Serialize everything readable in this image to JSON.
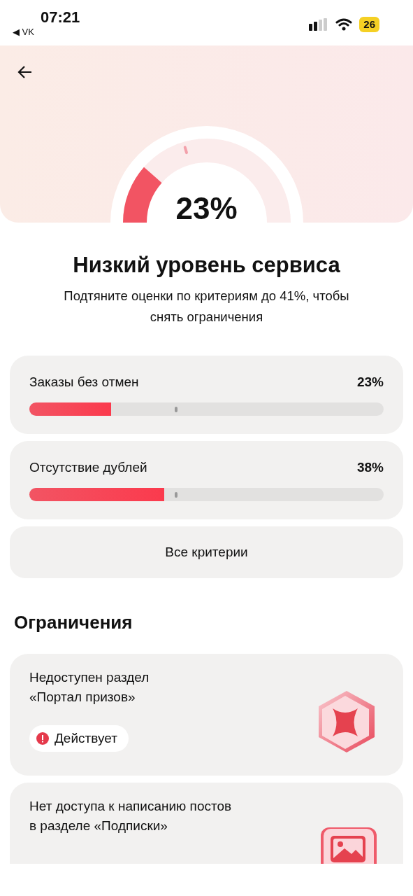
{
  "status_bar": {
    "time": "07:21",
    "back_link": "◀ VK",
    "battery": "26"
  },
  "score": {
    "value": "23%",
    "level": 0.23
  },
  "title": "Низкий уровень сервиса",
  "subtitle": "Подтяните оценки по критериям до 41%, чтобы снять ограничения",
  "criteria": [
    {
      "name": "Заказы без отмен",
      "value": "23%",
      "level": 0.23
    },
    {
      "name": "Отсутствие дублей",
      "value": "38%",
      "level": 0.38
    }
  ],
  "all_criteria_button": "Все критерии",
  "restrictions_heading": "Ограничения",
  "restrictions": [
    {
      "title_lines": [
        "Недоступен раздел",
        "«Портал призов»"
      ],
      "status": "Действует",
      "kind": "star"
    },
    {
      "title_lines": [
        "Нет доступа к написанию постов",
        "в разделе «Подписки»"
      ],
      "kind": "image"
    }
  ]
}
